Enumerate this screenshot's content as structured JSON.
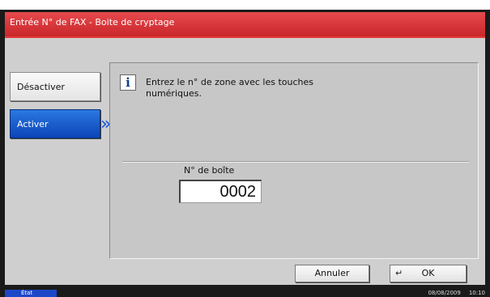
{
  "window": {
    "title": "Entrée N° de FAX - Boite de cryptage"
  },
  "mode": {
    "off_label": "Désactiver",
    "on_label": "Activer",
    "selected": "Activer"
  },
  "content": {
    "message": "Entrez le n° de zone avec les touches numériques.",
    "box_label": "N° de boîte",
    "box_value": "0002"
  },
  "buttons": {
    "cancel": "Annuler",
    "ok": "OK"
  },
  "status": {
    "state": "État",
    "date": "08/08/2009",
    "time": "10:10"
  },
  "colors": {
    "title_red": "#d9353a",
    "active_blue": "#1354d8"
  },
  "icons": {
    "info": "info-icon",
    "chevron": "double-chevron-right-icon",
    "enter": "enter-icon"
  }
}
